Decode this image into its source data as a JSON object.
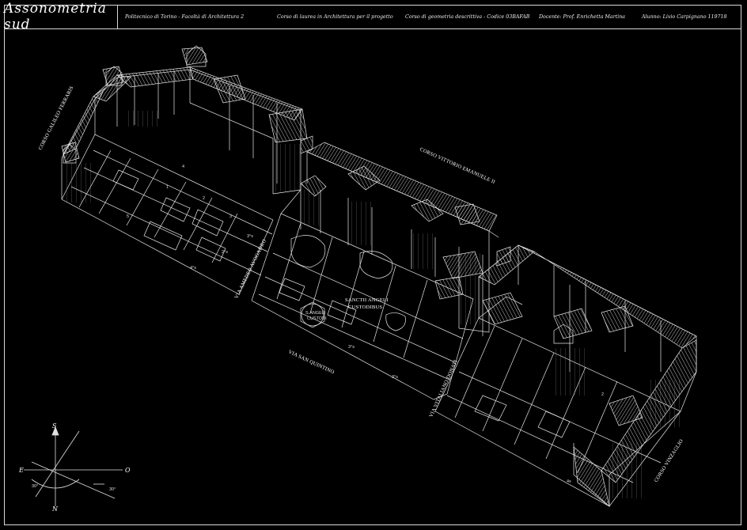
{
  "title": "Assonometria sud",
  "header": {
    "school": "Politecnico di Torino - Facoltà di Architettura 2",
    "course_degree": "Corso di laurea in Architettura per il progetto",
    "course": "Corso di geometria descrittiva - Codice 03BAFAB",
    "teacher": "Docente: Prof. Enrichetta Martina",
    "student": "Alunno: Livio Carpignano 119718"
  },
  "streets": {
    "corso_galileo_ferraris": "CORSO GALILEO FERRARIS",
    "corso_vittorio_emanuele": "CORSO VITTORIO EMANUELE II",
    "via_amedeo_avogadro": "VIA AMEDEO AVOGADRO",
    "via_san_quintino": "VIA SAN QUINTINO",
    "via_vitaliano_donati": "VIA VITALIANO DONATI",
    "corso_vinzaglio": "CORSO VINZAGLIO"
  },
  "labels": {
    "church_angels": "SANCTII ANGELI",
    "church_custodes": "CUSTODIBUS",
    "ring_1": "S.ANGELI",
    "ring_2": "CUSTODI"
  },
  "compass": {
    "south": "S",
    "north": "N",
    "east": "E",
    "west": "O",
    "angle_1": "30°",
    "angle_2": "30°"
  }
}
